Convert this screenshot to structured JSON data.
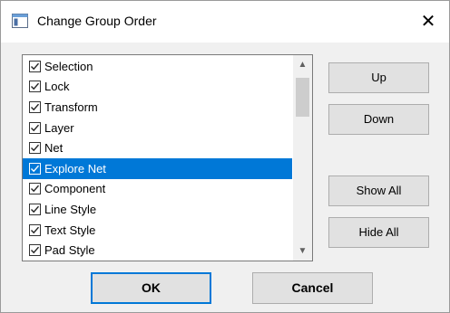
{
  "window": {
    "title": "Change Group Order",
    "close_glyph": "✕"
  },
  "list": {
    "items": [
      {
        "label": "Selection",
        "checked": true,
        "selected": false
      },
      {
        "label": "Lock",
        "checked": true,
        "selected": false
      },
      {
        "label": "Transform",
        "checked": true,
        "selected": false
      },
      {
        "label": "Layer",
        "checked": true,
        "selected": false
      },
      {
        "label": "Net",
        "checked": true,
        "selected": false
      },
      {
        "label": "Explore Net",
        "checked": true,
        "selected": true
      },
      {
        "label": "Component",
        "checked": true,
        "selected": false
      },
      {
        "label": "Line Style",
        "checked": true,
        "selected": false
      },
      {
        "label": "Text Style",
        "checked": true,
        "selected": false
      },
      {
        "label": "Pad Style",
        "checked": true,
        "selected": false
      }
    ],
    "scroll_up_glyph": "▲",
    "scroll_down_glyph": "▼"
  },
  "buttons": {
    "up": "Up",
    "down": "Down",
    "show_all": "Show All",
    "hide_all": "Hide All",
    "ok": "OK",
    "cancel": "Cancel"
  },
  "colors": {
    "selection": "#0078d7",
    "default_button_border": "#0078d7"
  },
  "icons": {
    "app": "dialog-app-icon",
    "close": "close-icon",
    "check": "checkmark-icon"
  }
}
